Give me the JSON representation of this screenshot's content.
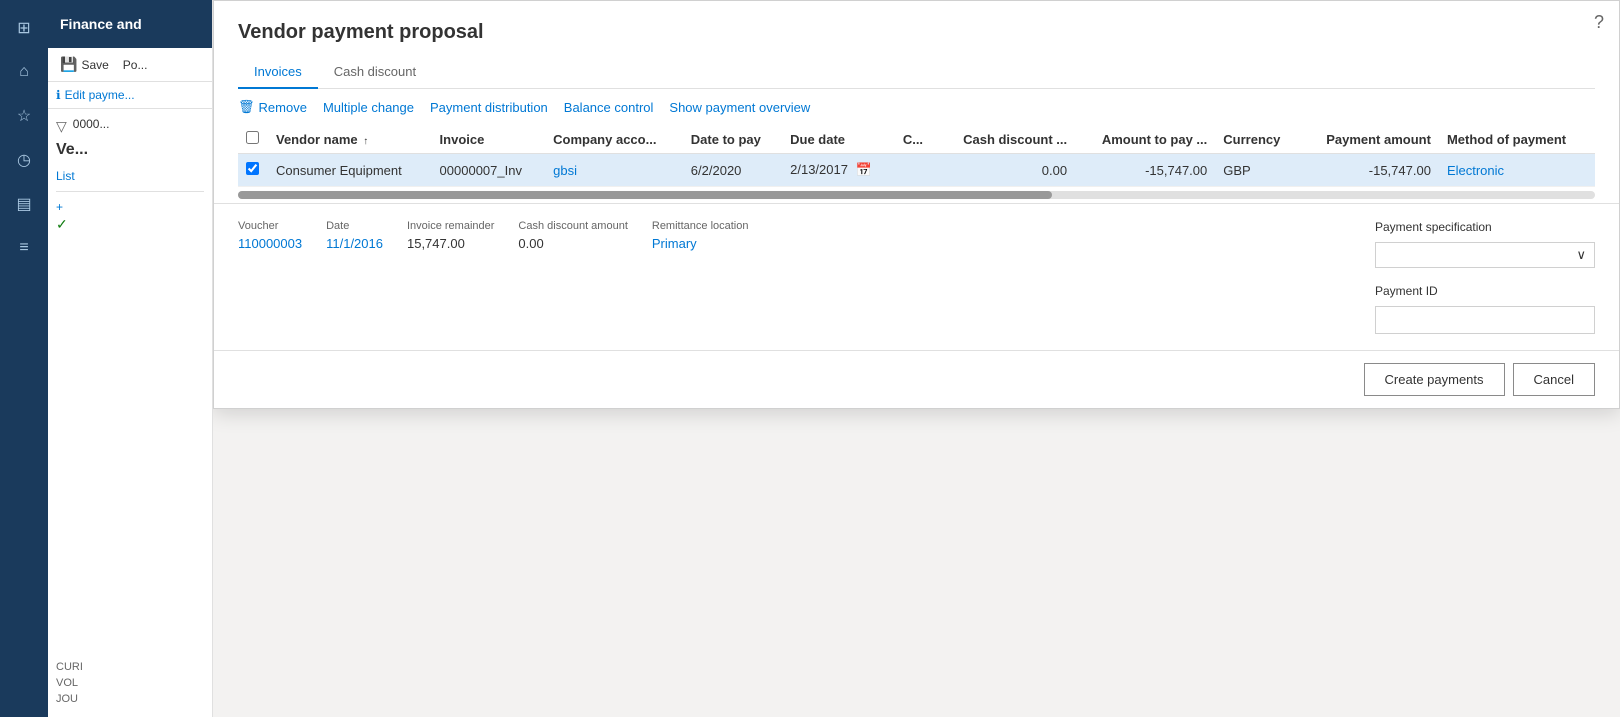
{
  "app": {
    "title": "Finance and",
    "help_icon": "?"
  },
  "sidebar": {
    "icons": [
      "grid",
      "home",
      "star",
      "clock",
      "chart",
      "list",
      "check"
    ]
  },
  "left_panel": {
    "toolbar": {
      "save_label": "Save",
      "post_label": "Po..."
    },
    "edit_payment_label": "Edit payme...",
    "filter_id": "0000...",
    "section_title": "Ve...",
    "list_label": "List",
    "add_btn": "+",
    "check_label": "",
    "bottom_sections": [
      {
        "label": "CURI"
      },
      {
        "label": "VOL"
      },
      {
        "label": "JOU"
      }
    ]
  },
  "dialog": {
    "title": "Vendor payment proposal",
    "tabs": [
      {
        "label": "Invoices",
        "active": true
      },
      {
        "label": "Cash discount",
        "active": false
      }
    ],
    "toolbar_actions": [
      {
        "label": "Remove",
        "icon": "🗑"
      },
      {
        "label": "Multiple change",
        "icon": ""
      },
      {
        "label": "Payment distribution",
        "icon": ""
      },
      {
        "label": "Balance control",
        "icon": ""
      },
      {
        "label": "Show payment overview",
        "icon": ""
      }
    ],
    "table": {
      "columns": [
        {
          "label": "",
          "key": "checkbox"
        },
        {
          "label": "Vendor name",
          "key": "vendor_name",
          "sortable": true
        },
        {
          "label": "Invoice",
          "key": "invoice"
        },
        {
          "label": "Company acco...",
          "key": "company_account"
        },
        {
          "label": "Date to pay",
          "key": "date_to_pay"
        },
        {
          "label": "Due date",
          "key": "due_date"
        },
        {
          "label": "C...",
          "key": "c"
        },
        {
          "label": "Cash discount ...",
          "key": "cash_discount",
          "align": "right"
        },
        {
          "label": "Amount to pay ...",
          "key": "amount_to_pay",
          "align": "right"
        },
        {
          "label": "Currency",
          "key": "currency"
        },
        {
          "label": "Payment amount",
          "key": "payment_amount",
          "align": "right"
        },
        {
          "label": "Method of payment",
          "key": "method_of_payment"
        }
      ],
      "rows": [
        {
          "checkbox": "",
          "vendor_name": "Consumer Equipment",
          "invoice": "00000007_Inv",
          "company_account": "gbsi",
          "date_to_pay": "6/2/2020",
          "due_date": "2/13/2017",
          "c": "",
          "cash_discount": "0.00",
          "amount_to_pay": "-15,747.00",
          "currency": "GBP",
          "payment_amount": "-15,747.00",
          "method_of_payment": "Electronic",
          "selected": true
        }
      ]
    },
    "details": {
      "voucher_label": "Voucher",
      "voucher_value": "110000003",
      "date_label": "Date",
      "date_value": "11/1/2016",
      "invoice_remainder_label": "Invoice remainder",
      "invoice_remainder_value": "15,747.00",
      "cash_discount_amount_label": "Cash discount amount",
      "cash_discount_amount_value": "0.00",
      "remittance_location_label": "Remittance location",
      "remittance_location_value": "Primary",
      "payment_specification_label": "Payment specification",
      "payment_specification_placeholder": "",
      "payment_id_label": "Payment ID",
      "payment_id_value": ""
    },
    "footer": {
      "create_payments_label": "Create payments",
      "cancel_label": "Cancel"
    }
  }
}
